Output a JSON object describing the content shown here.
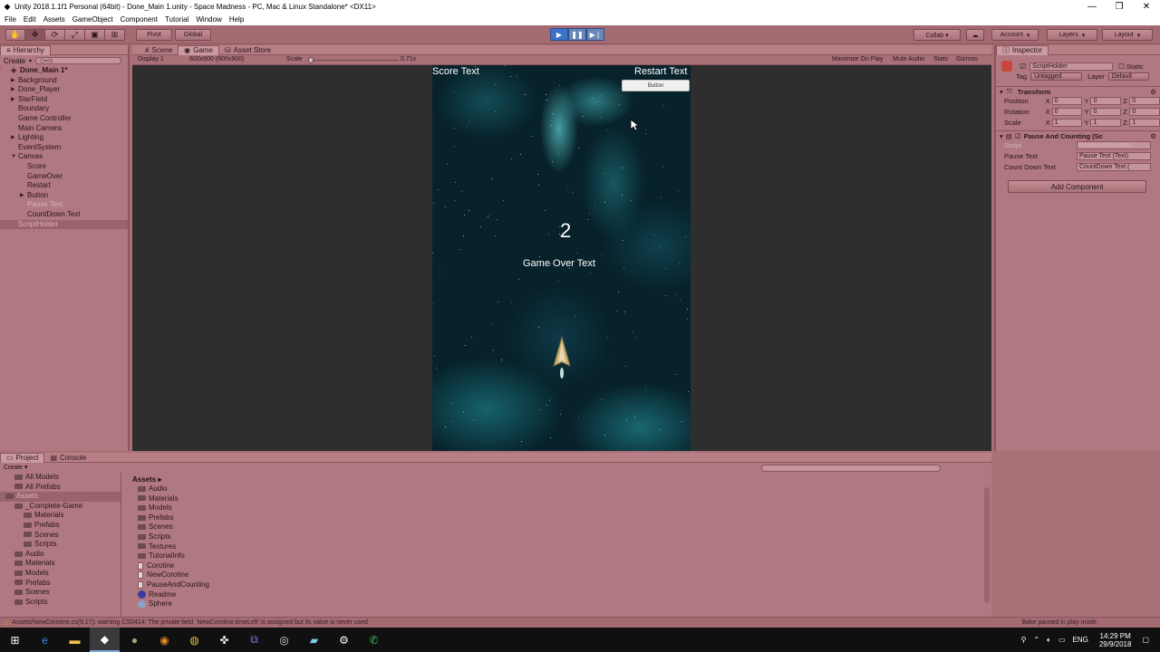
{
  "window": {
    "title": "Unity 2018.1.1f1 Personal (64bit) - Done_Main 1.unity - Space Madness - PC, Mac & Linux Standalone* <DX11>",
    "controls": [
      "—",
      "❐",
      "✕"
    ]
  },
  "menu": [
    "File",
    "Edit",
    "Assets",
    "GameObject",
    "Component",
    "Tutorial",
    "Window",
    "Help"
  ],
  "toolbar": {
    "pivot": "Pivot",
    "global": "Global",
    "collab": "Collab ▾",
    "layers": "Layers",
    "layout": "Layout",
    "account": "Account"
  },
  "hierarchy": {
    "tab": "Hierarchy",
    "create": "Create",
    "search_placeholder": "Q▾All",
    "items": [
      {
        "label": "Done_Main 1*",
        "depth": 0,
        "state": "scene"
      },
      {
        "label": "Background",
        "depth": 1,
        "arrow": true
      },
      {
        "label": "Done_Player",
        "depth": 1,
        "arrow": true
      },
      {
        "label": "StarField",
        "depth": 1,
        "arrow": true
      },
      {
        "label": "Boundary",
        "depth": 1
      },
      {
        "label": "Game Controller",
        "depth": 1
      },
      {
        "label": "Main Camera",
        "depth": 1
      },
      {
        "label": "Lighting",
        "depth": 1,
        "arrow": true
      },
      {
        "label": "EventSystem",
        "depth": 1
      },
      {
        "label": "Canvas",
        "depth": 1,
        "open": true
      },
      {
        "label": "Score",
        "depth": 2
      },
      {
        "label": "GameOver",
        "depth": 2
      },
      {
        "label": "Restart",
        "depth": 2
      },
      {
        "label": "Button",
        "depth": 2,
        "arrow": true
      },
      {
        "label": "Pause Text",
        "depth": 2,
        "state": "dim"
      },
      {
        "label": "CountDown Text",
        "depth": 2
      },
      {
        "label": "ScriptHolder",
        "depth": 1,
        "state": "sel"
      }
    ]
  },
  "scene_tabs": {
    "scene": "Scene",
    "game": "Game",
    "asset_store": "Asset Store"
  },
  "game_bar": {
    "display": "Display 1",
    "resolution": "600x900 (600x900)",
    "scale_label": "Scale",
    "scale_value": "0.71x",
    "maximize": "Maximize On Play",
    "mute": "Mute Audio",
    "stats": "Stats",
    "gizmos": "Gizmos"
  },
  "game": {
    "score_text": "Score Text",
    "restart_text": "Restart Text",
    "button": "Button",
    "countdown": "2",
    "gameover_text": "Game Over Text"
  },
  "inspector": {
    "tab": "Inspector",
    "object_name": "ScriptHolder",
    "static": "Static",
    "tag_label": "Tag",
    "tag_value": "Untagged",
    "layer_label": "Layer",
    "layer_value": "Default",
    "transform_title": "Transform",
    "transform": [
      {
        "label": "Position",
        "x": "0",
        "y": "0",
        "z": "0"
      },
      {
        "label": "Rotation",
        "x": "0",
        "y": "0",
        "z": "0"
      },
      {
        "label": "Scale",
        "x": "1",
        "y": "1",
        "z": "1"
      }
    ],
    "component_title": "Pause And Counting (Sc",
    "component_fields": [
      {
        "label": "Script",
        "value": "PauseAndCountin"
      },
      {
        "label": "Pause Text",
        "value": "Pause Text (Text)"
      },
      {
        "label": "Count Down Text",
        "value": "CountDown Text ("
      }
    ],
    "add_component": "Add Component"
  },
  "project": {
    "tab": "Project",
    "console_tab": "Console",
    "create": "Create",
    "tree": [
      {
        "label": "All Models",
        "depth": 1
      },
      {
        "label": "All Prefabs",
        "depth": 1
      },
      {
        "label": "Assets",
        "depth": 0,
        "state": "sel"
      },
      {
        "label": "_Complete-Game",
        "depth": 1
      },
      {
        "label": "Materials",
        "depth": 2
      },
      {
        "label": "Prefabs",
        "depth": 2
      },
      {
        "label": "Scenes",
        "depth": 2
      },
      {
        "label": "Scripts",
        "depth": 2
      },
      {
        "label": "Audio",
        "depth": 1
      },
      {
        "label": "Materials",
        "depth": 1
      },
      {
        "label": "Models",
        "depth": 1
      },
      {
        "label": "Prefabs",
        "depth": 1
      },
      {
        "label": "Scenes",
        "depth": 1
      },
      {
        "label": "Scripts",
        "depth": 1
      }
    ],
    "breadcrumb": "Assets ▸",
    "assets": [
      {
        "label": "Audio",
        "kind": "folder"
      },
      {
        "label": "Materials",
        "kind": "folder"
      },
      {
        "label": "Models",
        "kind": "folder"
      },
      {
        "label": "Prefabs",
        "kind": "folder"
      },
      {
        "label": "Scenes",
        "kind": "folder"
      },
      {
        "label": "Scripts",
        "kind": "folder"
      },
      {
        "label": "Textures",
        "kind": "folder"
      },
      {
        "label": "TutorialInfo",
        "kind": "folder"
      },
      {
        "label": "Corotine",
        "kind": "script"
      },
      {
        "label": "NewCorotine",
        "kind": "script"
      },
      {
        "label": "PauseAndCounting",
        "kind": "script"
      },
      {
        "label": "Readme",
        "kind": "info"
      },
      {
        "label": "Sphere",
        "kind": "mesh"
      }
    ]
  },
  "status": {
    "message": "Assets/NewCorotine.cs(9,17): warning CS0414: The private field `NewCorotine.timeLeft' is assigned but its value is never used",
    "right": "Bake paused in play mode"
  },
  "taskbar": {
    "icons": [
      "windows-start-icon",
      "edge-icon",
      "file-explorer-icon",
      "unity-icon",
      "gimp-icon",
      "blender-icon",
      "chrome-icon",
      "unity-hub-icon",
      "visual-studio-icon",
      "media-icon",
      "notepad-icon",
      "settings-icon",
      "whatsapp-icon"
    ],
    "lang": "ENG",
    "time": "14:29 PM",
    "date": "29/9/2018"
  }
}
